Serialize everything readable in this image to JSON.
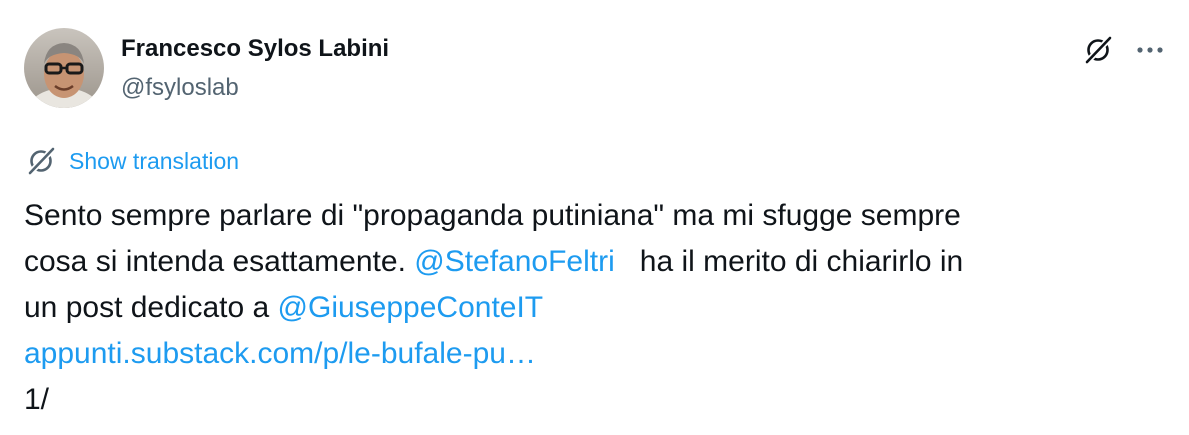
{
  "author": {
    "display_name": "Francesco Sylos Labini",
    "handle": "@fsyloslab"
  },
  "header_icons": {
    "grok": "grok-icon",
    "more": "more-dots-icon"
  },
  "translation": {
    "label": "Show translation",
    "icon": "translate-icon"
  },
  "tweet": {
    "line1": "Sento sempre parlare di \"propaganda putiniana\" ma mi sfugge sempre",
    "line2_pre": "cosa si intenda esattamente. ",
    "mention1": "@StefanoFeltri",
    "line2_post": "   ha il merito di chiarirlo in",
    "line3_pre": "un post dedicato a ",
    "mention2": "@GiuseppeConteIT",
    "url": "appunti.substack.com/p/le-bufale-pu…",
    "thread_marker": "1/"
  },
  "colors": {
    "accent": "#1d9bf0",
    "text": "#0f1419",
    "secondary": "#536471"
  }
}
